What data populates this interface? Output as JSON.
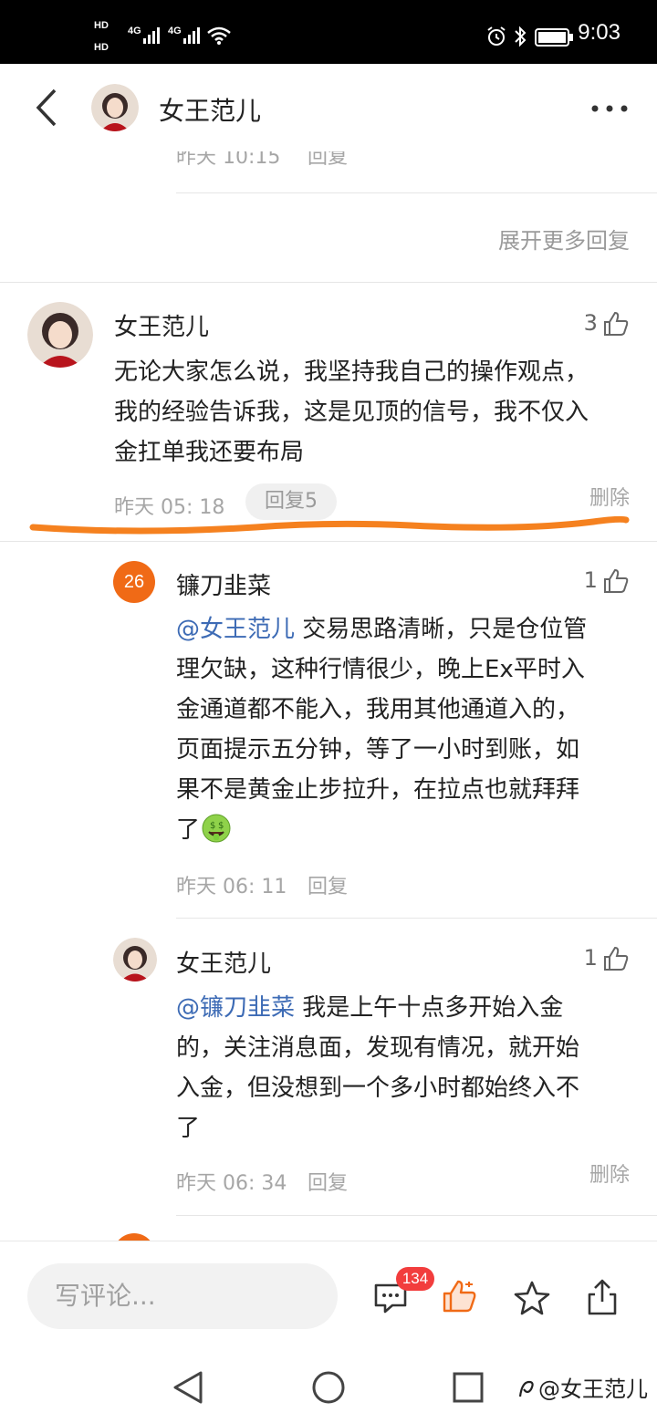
{
  "status_bar": {
    "sim1": "HD",
    "sim2": "HD",
    "net1": "4G",
    "net2": "4G",
    "time": "9:03"
  },
  "header": {
    "title": "女王范儿"
  },
  "prev_thread": {
    "meta_time": "昨天 10:15",
    "reply_label": "回复",
    "expand_more": "展开更多回复"
  },
  "main_comment": {
    "author": "女王范儿",
    "likes": "3",
    "text": [
      "无论大家怎么说，我坚持我自己的操作观点，",
      "我的经验告诉我，这是见顶的信号，我不仅入",
      "金扛单我还要布局"
    ],
    "time": "昨天 05: 18",
    "reply_pill": "回复5",
    "delete": "删除"
  },
  "replies": [
    {
      "badge": "26",
      "author": "镰刀韭菜",
      "likes": "1",
      "mention": "@女王范儿",
      "first_line": " 交易思路清晰，只是仓位管",
      "lines": [
        "理欠缺，这种行情很少，晚上Ex平时入",
        "金通道都不能入，我用其他通道入的，",
        "页面提示五分钟，等了一小时到账，如",
        "果不是黄金止步拉升，在拉点也就拜拜",
        "了"
      ],
      "time": "昨天 06: 11",
      "reply_label": "回复"
    },
    {
      "author": "女王范儿",
      "likes": "1",
      "mention": "@镰刀韭菜",
      "first_line": " 我是上午十点多开始入金",
      "lines": [
        "的，关注消息面，发现有情况，就开始",
        "入金，但没想到一个多小时都始终入不",
        "了"
      ],
      "time": "昨天 06: 34",
      "reply_label": "回复",
      "delete": "删除"
    }
  ],
  "bottom_bar": {
    "input_placeholder": "写评论...",
    "comment_count": "134"
  },
  "watermark": "@女王范儿",
  "colors": {
    "accent_orange": "#f06a16",
    "mention_blue": "#3d6bb5",
    "badge_red": "#f23d3d",
    "annotation_line": "#f5811f"
  },
  "icons": [
    "back-icon",
    "more-icon",
    "thumb-up-icon",
    "comment-icon",
    "like-icon",
    "star-icon",
    "share-icon",
    "money-face-emoji",
    "nav-back-icon",
    "nav-home-icon",
    "nav-recent-icon"
  ]
}
